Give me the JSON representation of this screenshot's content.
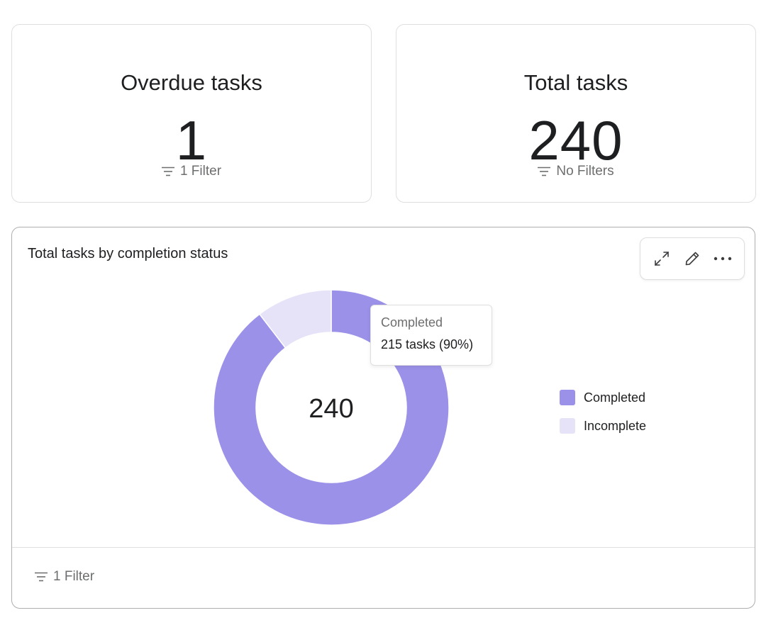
{
  "cards": {
    "overdue": {
      "title": "Overdue tasks",
      "value": "1",
      "filter_label": "1 Filter"
    },
    "total": {
      "title": "Total tasks",
      "value": "240",
      "filter_label": "No Filters"
    }
  },
  "chart_card": {
    "title": "Total tasks by completion status",
    "toolbar": {
      "expand_icon": "expand-icon",
      "edit_icon": "pencil-icon",
      "more_icon": "more-horizontal-icon"
    },
    "center_label": "240",
    "tooltip": {
      "title": "Completed",
      "value": "215 tasks (90%)"
    },
    "footer_filter_label": "1 Filter"
  },
  "colors": {
    "completed": "#9b91e9",
    "incomplete": "#e6e3f9",
    "text": "#1e1f21",
    "muted": "#6d6e6f",
    "border": "#e0dfe0"
  },
  "chart_data": {
    "type": "pie",
    "donut": true,
    "categories": [
      "Completed",
      "Incomplete"
    ],
    "values": [
      215,
      25
    ],
    "total": 240,
    "title": "Total tasks by completion status",
    "legend_position": "right"
  }
}
